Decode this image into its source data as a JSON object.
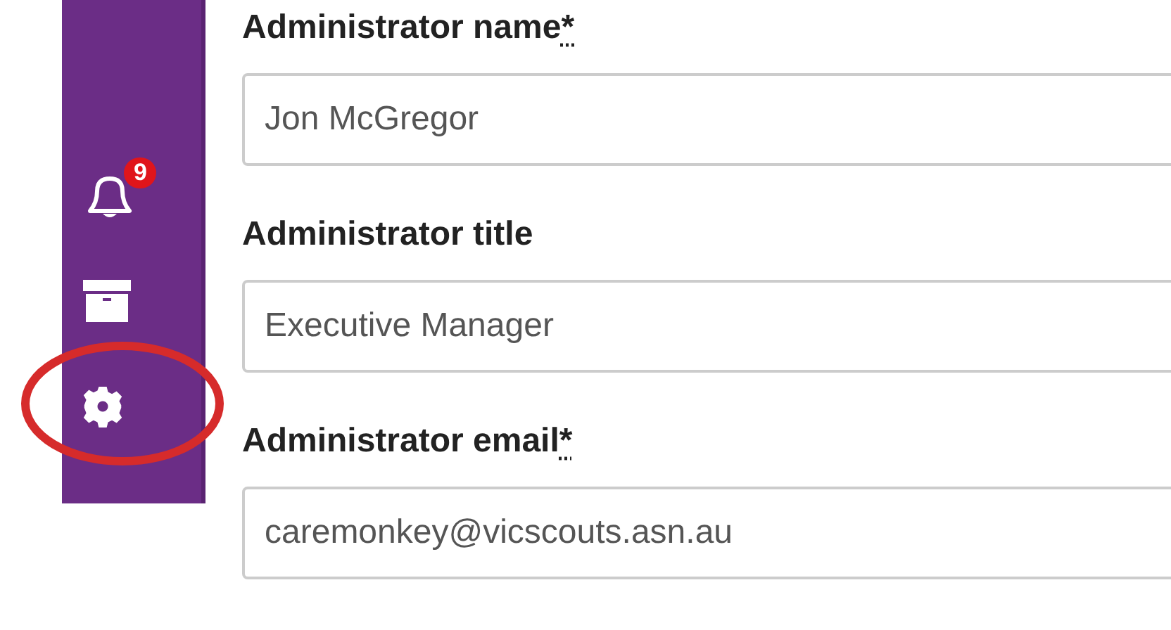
{
  "sidebar": {
    "items": [
      {
        "kind": "bell",
        "badge": "9"
      },
      {
        "kind": "box"
      },
      {
        "kind": "gear",
        "highlighted": true
      }
    ]
  },
  "form": {
    "fields": [
      {
        "label": "Administrator name",
        "required_mark": "*",
        "value": "Jon McGregor"
      },
      {
        "label": "Administrator title",
        "value": "Executive Manager"
      },
      {
        "label": "Administrator email",
        "required_mark": "*",
        "value": "caremonkey@vicscouts.asn.au"
      }
    ]
  }
}
